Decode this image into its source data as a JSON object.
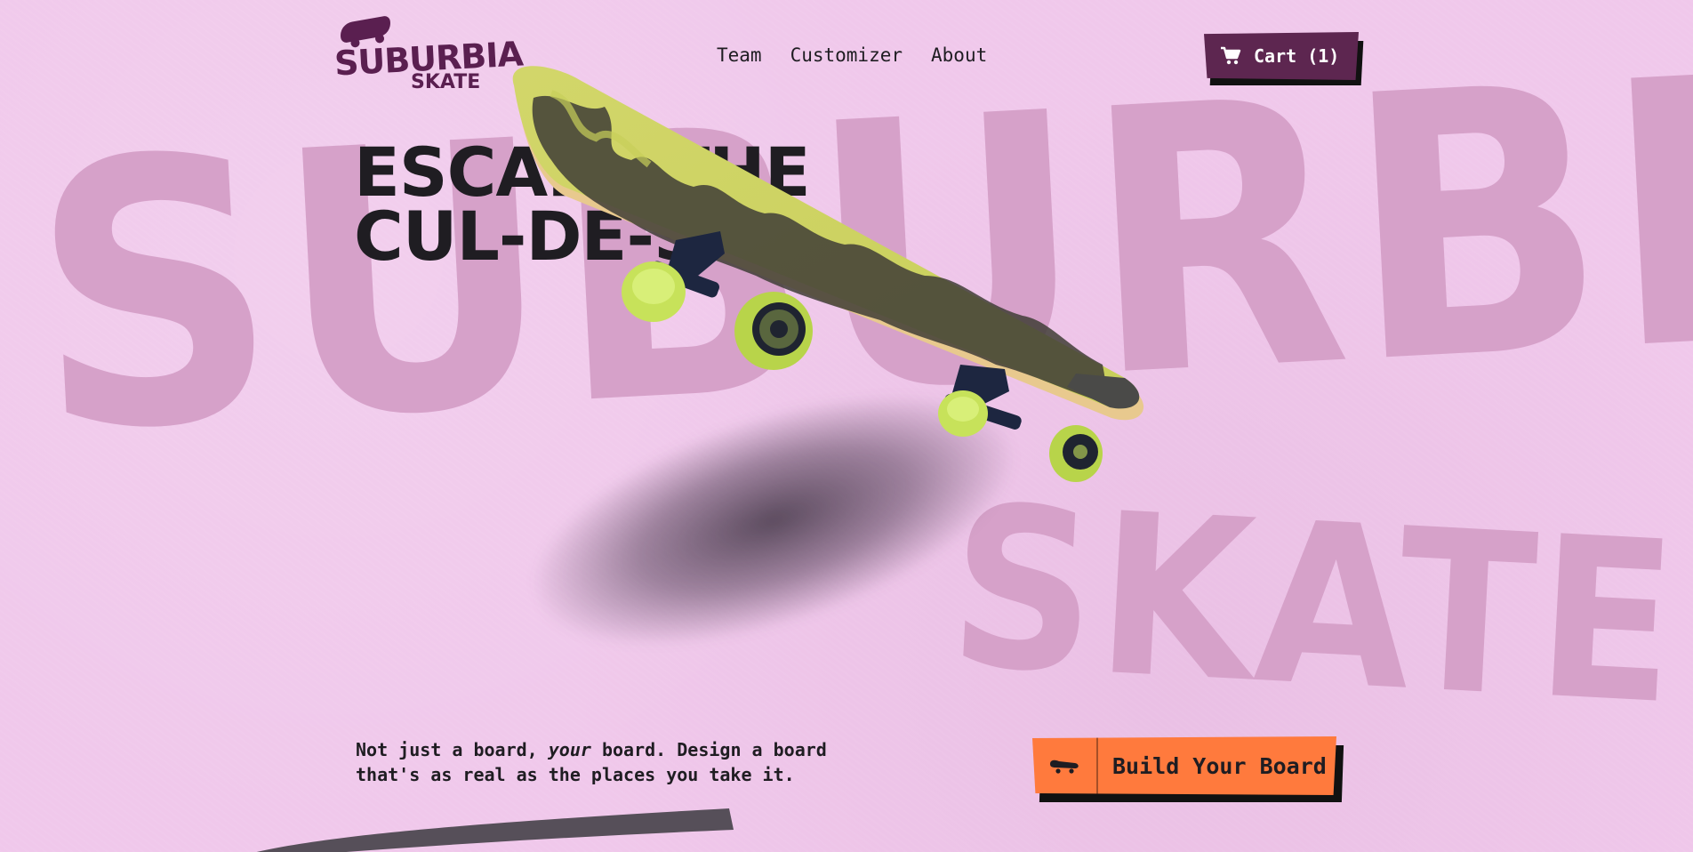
{
  "brand": {
    "logo_line1": "SUBURBIA",
    "logo_line2": "SKATE",
    "accent": "#5d2650",
    "cta_color": "#ff7a3d",
    "background": "#f0c8eb"
  },
  "background_text": {
    "word1": "SUBURBIA",
    "word2": "SKATE"
  },
  "nav": {
    "items": [
      {
        "label": "Team"
      },
      {
        "label": "Customizer"
      },
      {
        "label": "About"
      }
    ]
  },
  "cart": {
    "label": "Cart (1)",
    "icon": "shopping-cart-icon"
  },
  "hero": {
    "headline_line1": "ESCAPE THE",
    "headline_line2": "CUL-DE-SAC",
    "subtext_before": "Not just a board, ",
    "subtext_emph": "your",
    "subtext_after": " board. Design a board that's as real as the places you take it.",
    "cta_label": "Build Your Board",
    "cta_icon": "skateboard-icon",
    "product_image": "skateboard-image"
  }
}
